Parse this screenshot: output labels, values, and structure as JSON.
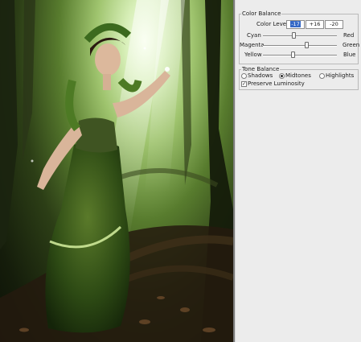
{
  "canvas": {
    "image_description_icon": "forest-fairy-photo-icon"
  },
  "color_balance": {
    "title": "Color Balance",
    "levels_label": "Color Levels:",
    "levels": [
      "-17",
      "+16",
      "-20"
    ],
    "sliders": [
      {
        "left": "Cyan",
        "right": "Red",
        "value": -17
      },
      {
        "left": "Magenta",
        "right": "Green",
        "value": 16
      },
      {
        "left": "Yellow",
        "right": "Blue",
        "value": -20
      }
    ]
  },
  "tone_balance": {
    "title": "Tone Balance",
    "options": [
      "Shadows",
      "Midtones",
      "Highlights"
    ],
    "selected": "Midtones",
    "preserve_label": "Preserve Luminosity",
    "preserve_checked": true
  }
}
